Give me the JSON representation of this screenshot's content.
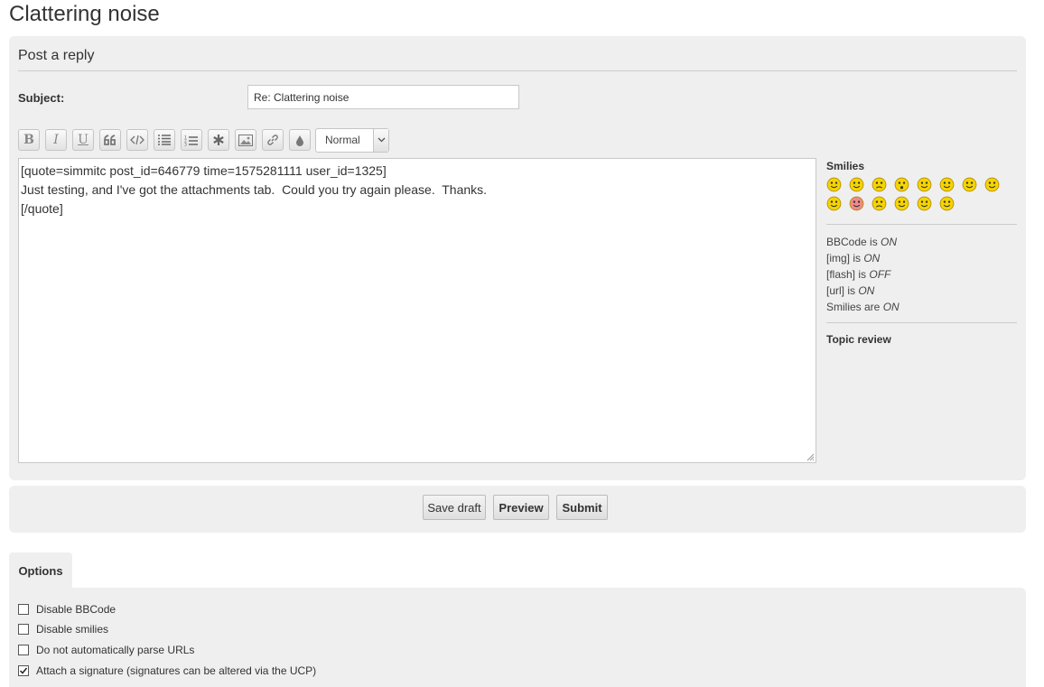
{
  "page": {
    "title": "Clattering noise"
  },
  "form": {
    "heading": "Post a reply",
    "subject_label": "Subject:",
    "subject_value": "Re: Clattering noise",
    "message_text": "[quote=simmitc post_id=646779 time=1575281111 user_id=1325]\nJust testing, and I've got the attachments tab.  Could you try again please.  Thanks.\n[/quote]"
  },
  "toolbar": {
    "buttons": [
      {
        "name": "bold",
        "icon": "bold-icon",
        "glyph": "B"
      },
      {
        "name": "italic",
        "icon": "italic-icon",
        "glyph": "I"
      },
      {
        "name": "underline",
        "icon": "underline-icon",
        "glyph": "U"
      },
      {
        "name": "quote",
        "icon": "quote-icon"
      },
      {
        "name": "code",
        "icon": "code-icon"
      },
      {
        "name": "list",
        "icon": "list-icon"
      },
      {
        "name": "ordered-list",
        "icon": "ordered-list-icon"
      },
      {
        "name": "list-item",
        "icon": "asterisk-icon"
      },
      {
        "name": "image",
        "icon": "image-icon"
      },
      {
        "name": "url",
        "icon": "link-icon"
      },
      {
        "name": "color",
        "icon": "droplet-icon"
      }
    ],
    "font_size_selected": "Normal"
  },
  "sidebar": {
    "smilies_title": "Smilies",
    "smilies": [
      {
        "name": "very-happy",
        "color": "#f5d400"
      },
      {
        "name": "smile",
        "color": "#f5d400"
      },
      {
        "name": "sad",
        "color": "#f5d400"
      },
      {
        "name": "eek",
        "color": "#f5d400"
      },
      {
        "name": "confused",
        "color": "#f5d400"
      },
      {
        "name": "cool",
        "color": "#f5d400"
      },
      {
        "name": "laughing",
        "color": "#f5d400"
      },
      {
        "name": "mad",
        "color": "#f5d400"
      },
      {
        "name": "razz",
        "color": "#f5d400"
      },
      {
        "name": "embarrassed",
        "color": "#f08a8a"
      },
      {
        "name": "crying",
        "color": "#f5d400"
      },
      {
        "name": "evil",
        "color": "#f5d400"
      },
      {
        "name": "rolling-eyes",
        "color": "#f5d400"
      },
      {
        "name": "wink",
        "color": "#f5d400"
      }
    ],
    "status": [
      {
        "label": "BBCode is ",
        "value": "ON"
      },
      {
        "label": "[img] is ",
        "value": "ON"
      },
      {
        "label": "[flash] is ",
        "value": "OFF"
      },
      {
        "label": "[url] is ",
        "value": "ON"
      },
      {
        "label": "Smilies are ",
        "value": "ON"
      }
    ],
    "topic_review": "Topic review"
  },
  "actions": {
    "save_draft": "Save draft",
    "preview": "Preview",
    "submit": "Submit"
  },
  "options": {
    "tab_label": "Options",
    "items": [
      {
        "label": "Disable BBCode",
        "checked": false
      },
      {
        "label": "Disable smilies",
        "checked": false
      },
      {
        "label": "Do not automatically parse URLs",
        "checked": false
      },
      {
        "label": "Attach a signature (signatures can be altered via the UCP)",
        "checked": true
      }
    ]
  }
}
